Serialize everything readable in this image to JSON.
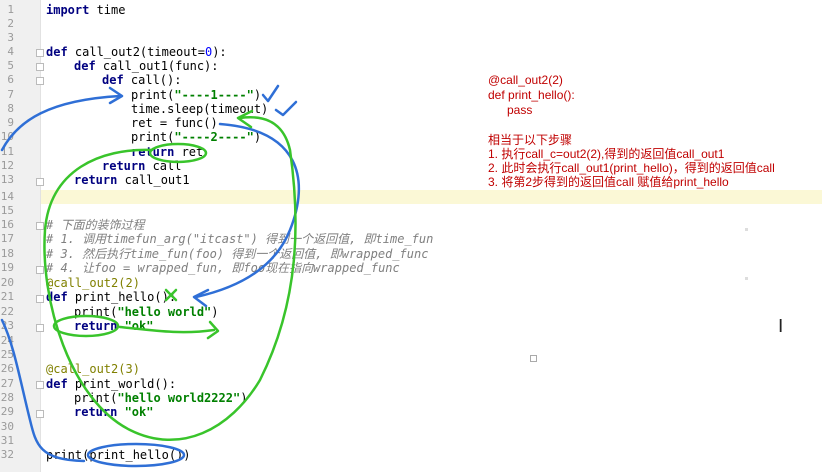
{
  "editor": {
    "line_numbers": [
      "1",
      "2",
      "3",
      "4",
      "5",
      "6",
      "7",
      "8",
      "9",
      "10",
      "11",
      "12",
      "13",
      "14",
      "15",
      "16",
      "17",
      "18",
      "19",
      "20",
      "21",
      "22",
      "23",
      "24",
      "25",
      "26",
      "27",
      "28",
      "29",
      "30",
      "31",
      "32"
    ],
    "code": {
      "l1_kw": "import",
      "l1_rest": " time",
      "l4_kw": "def",
      "l4_a": " call_out2(timeout=",
      "l4_num": "0",
      "l4_b": "):",
      "l5_kw": "def",
      "l5_rest": " call_out1(func):",
      "l6_kw": "def",
      "l6_rest": " call():",
      "l7_a": "print(",
      "l7_str": "\"----1----\"",
      "l7_b": ")",
      "l8": "time.sleep(timeout)",
      "l9": "ret = func()",
      "l10_a": "print(",
      "l10_str": "\"----2----\"",
      "l10_b": ")",
      "l11_kw": "return",
      "l11_rest": " ret",
      "l12_kw": "return",
      "l12_rest": " call",
      "l13_kw": "return",
      "l13_rest": " call_out1",
      "l16": "# 下面的装饰过程",
      "l17": "# 1. 调用timefun_arg(\"itcast\") 得到一个返回值, 即time_fun",
      "l18": "# 3. 然后执行time_fun(foo) 得到一个返回值, 即wrapped_func",
      "l19": "# 4. 让foo = wrapped_fun, 即foo现在指向wrapped_func",
      "l20": "@call_out2(2)",
      "l21_kw": "def",
      "l21_rest": " print_hello():",
      "l22_a": "print(",
      "l22_str": "\"hello world\"",
      "l22_b": ")",
      "l23_kw": "return",
      "l23_str": " \"ok\"",
      "l26": "@call_out2(3)",
      "l27_kw": "def",
      "l27_rest": " print_world():",
      "l28_a": "print(",
      "l28_str": "\"hello world2222\"",
      "l28_b": ")",
      "l29_kw": "return",
      "l29_str": " \"ok\"",
      "l32": "print(print_hello())"
    }
  },
  "notes": {
    "n1": "@call_out2(2)",
    "n2": "def print_hello():",
    "n3": "pass",
    "n4": "相当于以下步骤",
    "n5": "1. 执行call_c=out2(2),得到的返回值call_out1",
    "n6": "2. 此时会执行call_out1(print_hello)，得到的返回值call",
    "n7": "3. 将第2步得到的返回值call 赋值给print_hello"
  },
  "colors": {
    "keyword": "#000080",
    "string": "#008000",
    "comment": "#808080",
    "decorator": "#808000",
    "note": "#c00000",
    "annotation_blue": "#2f6fd6",
    "annotation_green": "#39c42b"
  }
}
